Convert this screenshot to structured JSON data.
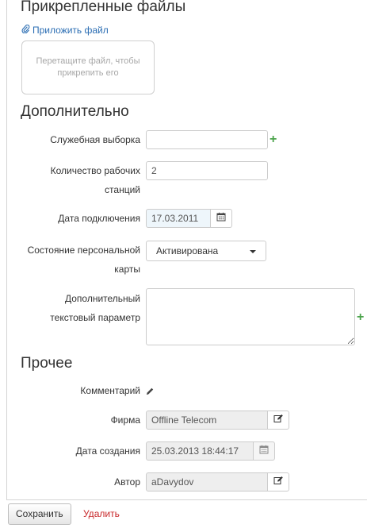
{
  "attachments": {
    "title": "Прикрепленные файлы",
    "attach_link": "Приложить файл",
    "dropzone_text": "Перетащите файл, чтобы прикрепить его"
  },
  "additional": {
    "title": "Дополнительно",
    "service_selection": {
      "label": "Служебная выборка",
      "value": ""
    },
    "workstations": {
      "label_line1": "Количество рабочих",
      "label_line2": "станций",
      "value": "2"
    },
    "connection_date": {
      "label": "Дата подключения",
      "value": "17.03.2011"
    },
    "personal_card_state": {
      "label_line1": "Состояние персональной",
      "label_line2": "карты",
      "selected": "Активирована"
    },
    "extra_text_param": {
      "label_line1": "Дополнительный",
      "label_line2": "текстовый параметр",
      "value": ""
    }
  },
  "other": {
    "title": "Прочее",
    "comment": {
      "label": "Комментарий"
    },
    "company": {
      "label": "Фирма",
      "value": "Offline Telecom"
    },
    "created_date": {
      "label": "Дата создания",
      "value": "25.03.2013 18:44:17"
    },
    "author": {
      "label": "Автор",
      "value": "aDavydov"
    }
  },
  "actions": {
    "save_label": "Сохранить",
    "delete_label": "Удалить"
  },
  "colors": {
    "link": "#2a6db3",
    "add": "#4aa34a",
    "delete": "#c8282a"
  }
}
